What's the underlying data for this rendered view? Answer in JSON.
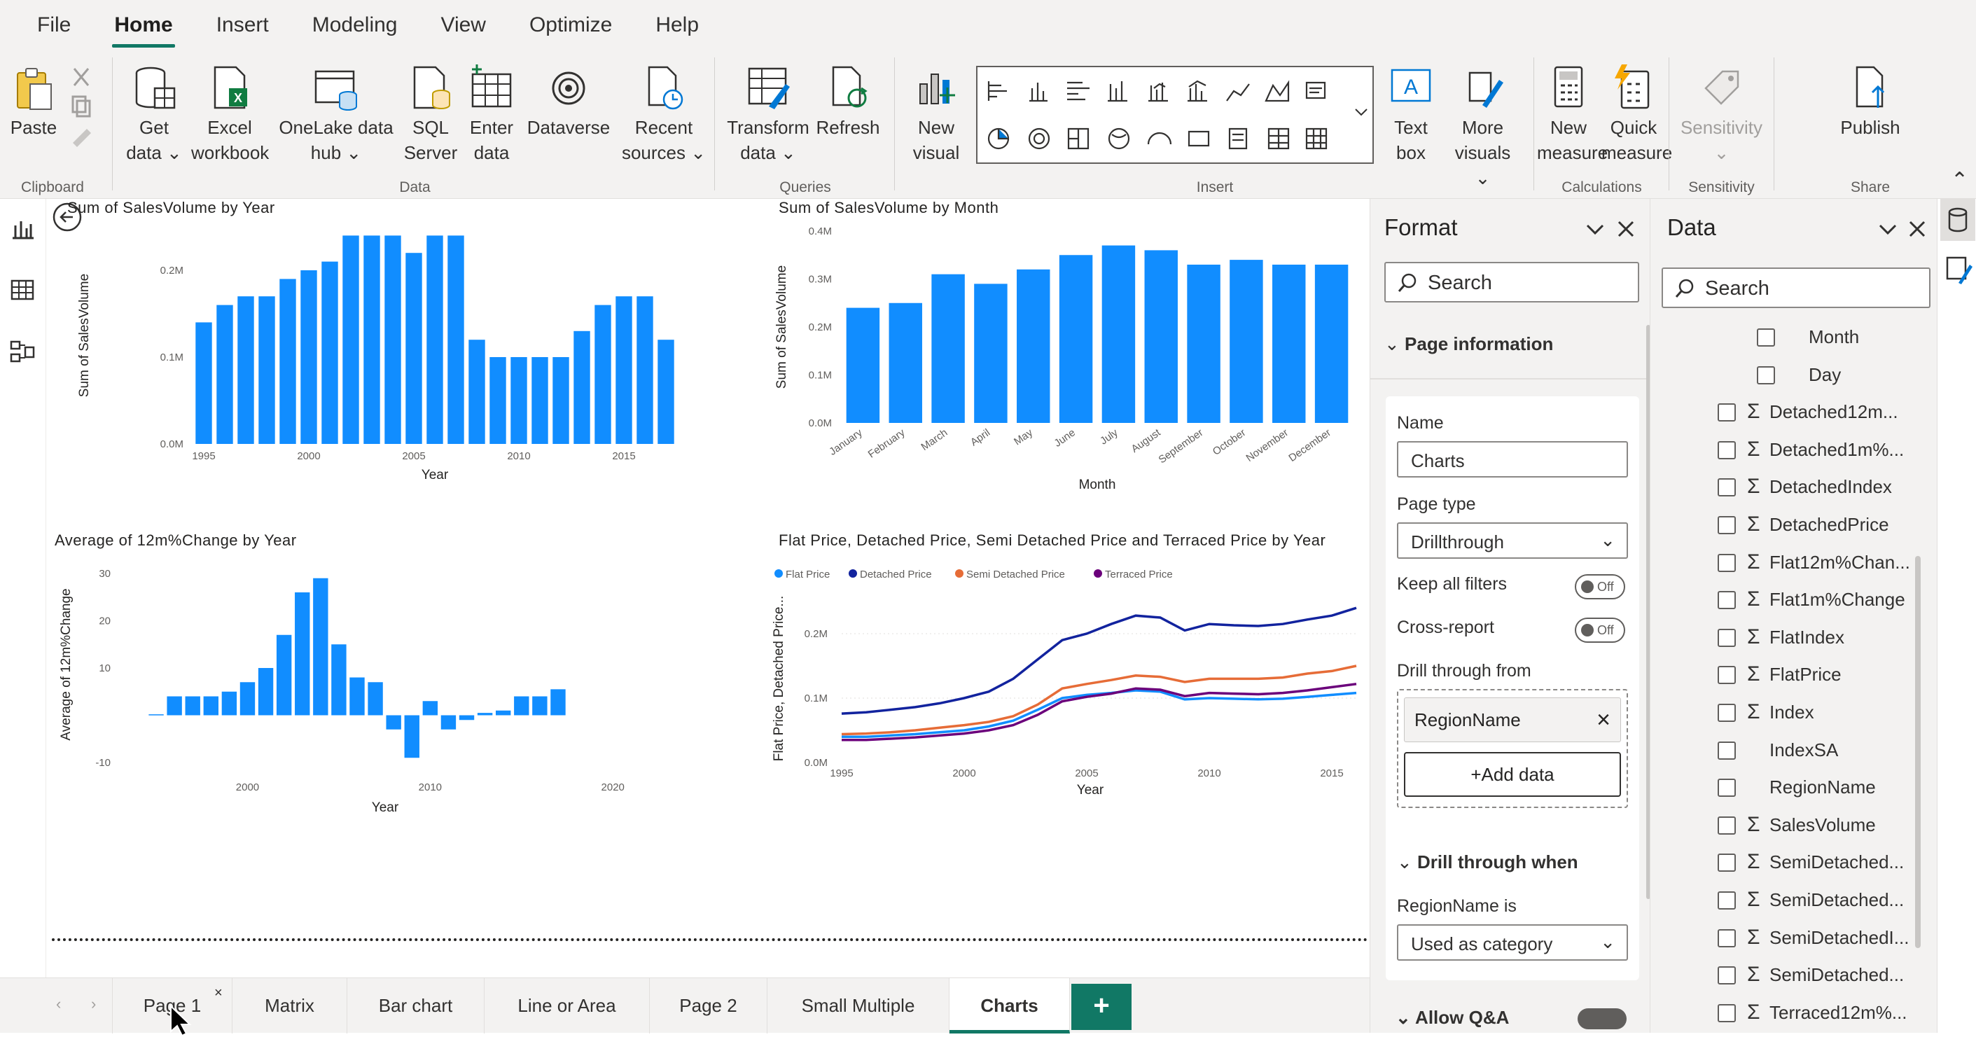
{
  "menu": {
    "items": [
      "File",
      "Home",
      "Insert",
      "Modeling",
      "View",
      "Optimize",
      "Help"
    ],
    "active": "Home"
  },
  "ribbon": {
    "clipboard": {
      "paste": "Paste",
      "group": "Clipboard"
    },
    "data": {
      "get_data": "Get",
      "get_data2": "data",
      "excel": "Excel",
      "excel2": "workbook",
      "onelake": "OneLake data",
      "onelake2": "hub",
      "sql": "SQL",
      "sql2": "Server",
      "enter": "Enter",
      "enter2": "data",
      "dataverse": "Dataverse",
      "recent": "Recent",
      "recent2": "sources",
      "group": "Data"
    },
    "queries": {
      "transform": "Transform",
      "transform2": "data",
      "refresh": "Refresh",
      "group": "Queries"
    },
    "insert": {
      "new_visual": "New",
      "new_visual2": "visual",
      "text_box": "Text",
      "text_box2": "box",
      "more_visuals": "More",
      "more_visuals2": "visuals",
      "group": "Insert"
    },
    "calculations": {
      "new_measure": "New",
      "new_measure2": "measure",
      "quick_measure": "Quick",
      "quick_measure2": "measure",
      "group": "Calculations"
    },
    "sensitivity": {
      "label": "Sensitivity",
      "group": "Sensitivity"
    },
    "share": {
      "publish": "Publish",
      "group": "Share"
    }
  },
  "charts": {
    "c1": {
      "title": "Sum of SalesVolume by Year",
      "xlabel": "Year",
      "ylabel": "Sum of SalesVolume",
      "yticks": [
        "0.2M",
        "0.1M",
        "0.0M"
      ],
      "xticks": [
        "1995",
        "2000",
        "2005",
        "2010",
        "2015"
      ]
    },
    "c2": {
      "title": "Sum of SalesVolume by Month",
      "xlabel": "Month",
      "ylabel": "Sum of SalesVolume",
      "yticks": [
        "0.4M",
        "0.3M",
        "0.2M",
        "0.1M",
        "0.0M"
      ]
    },
    "c3": {
      "title": "Average of 12m%Change by Year",
      "xlabel": "Year",
      "ylabel": "Average of 12m%Change",
      "yticks": [
        "30",
        "20",
        "10",
        "-10"
      ],
      "xticks": [
        "2000",
        "2010",
        "2020"
      ]
    },
    "c4": {
      "title": "Flat Price, Detached Price, Semi Detached Price and Terraced Price by Year",
      "xlabel": "Year",
      "ylabel": "Flat Price, Detached Price...",
      "yticks": [
        "0.2M",
        "0.1M",
        "0.0M"
      ],
      "xticks": [
        "1995",
        "2000",
        "2005",
        "2010",
        "2015"
      ],
      "legend": [
        "Flat Price",
        "Detached Price",
        "Semi Detached Price",
        "Terraced Price"
      ]
    }
  },
  "chart_data": [
    {
      "type": "bar",
      "title": "Sum of SalesVolume by Year",
      "xlabel": "Year",
      "ylabel": "Sum of SalesVolume",
      "ylim": [
        0,
        0.25
      ],
      "categories": [
        "1995",
        "1996",
        "1997",
        "1998",
        "1999",
        "2000",
        "2001",
        "2002",
        "2003",
        "2004",
        "2005",
        "2006",
        "2007",
        "2008",
        "2009",
        "2010",
        "2011",
        "2012",
        "2013",
        "2014",
        "2015",
        "2016",
        "2017"
      ],
      "values": [
        0.14,
        0.16,
        0.17,
        0.17,
        0.19,
        0.2,
        0.21,
        0.24,
        0.24,
        0.24,
        0.22,
        0.24,
        0.24,
        0.12,
        0.1,
        0.1,
        0.1,
        0.1,
        0.13,
        0.16,
        0.17,
        0.17,
        0.12
      ]
    },
    {
      "type": "bar",
      "title": "Sum of SalesVolume by Month",
      "xlabel": "Month",
      "ylabel": "Sum of SalesVolume",
      "ylim": [
        0,
        0.4
      ],
      "categories": [
        "January",
        "February",
        "March",
        "April",
        "May",
        "June",
        "July",
        "August",
        "September",
        "October",
        "November",
        "December"
      ],
      "values": [
        0.24,
        0.25,
        0.31,
        0.29,
        0.32,
        0.35,
        0.37,
        0.36,
        0.33,
        0.34,
        0.33,
        0.33
      ]
    },
    {
      "type": "bar",
      "title": "Average of 12m%Change by Year",
      "xlabel": "Year",
      "ylabel": "Average of 12m%Change",
      "ylim": [
        -10,
        30
      ],
      "categories": [
        "1995",
        "1996",
        "1997",
        "1998",
        "1999",
        "2000",
        "2001",
        "2002",
        "2003",
        "2004",
        "2005",
        "2006",
        "2007",
        "2008",
        "2009",
        "2010",
        "2011",
        "2012",
        "2013",
        "2014",
        "2015",
        "2016",
        "2017"
      ],
      "values": [
        0.2,
        4,
        4,
        4,
        5,
        7,
        10,
        17,
        26,
        29,
        15,
        8,
        7,
        -3,
        -9,
        3,
        -3,
        -1,
        0.5,
        1,
        4,
        4,
        5.5
      ]
    },
    {
      "type": "line",
      "title": "Flat Price, Detached Price, Semi Detached Price and Terraced Price by Year",
      "xlabel": "Year",
      "ylabel": "Flat Price, Detached Price...",
      "ylim": [
        0,
        0.25
      ],
      "x": [
        1995,
        1996,
        1997,
        1998,
        1999,
        2000,
        2001,
        2002,
        2003,
        2004,
        2005,
        2006,
        2007,
        2008,
        2009,
        2010,
        2011,
        2012,
        2013,
        2014,
        2015,
        2016
      ],
      "series": [
        {
          "name": "Flat Price",
          "color": "#118DFF",
          "values": [
            0.04,
            0.04,
            0.042,
            0.044,
            0.047,
            0.05,
            0.056,
            0.065,
            0.082,
            0.1,
            0.105,
            0.108,
            0.112,
            0.11,
            0.098,
            0.1,
            0.099,
            0.098,
            0.099,
            0.102,
            0.105,
            0.108
          ]
        },
        {
          "name": "Detached Price",
          "color": "#12239E",
          "values": [
            0.076,
            0.078,
            0.082,
            0.086,
            0.092,
            0.1,
            0.11,
            0.13,
            0.16,
            0.19,
            0.2,
            0.215,
            0.228,
            0.225,
            0.205,
            0.215,
            0.213,
            0.212,
            0.215,
            0.222,
            0.228,
            0.24
          ]
        },
        {
          "name": "Semi Detached Price",
          "color": "#E66C37",
          "values": [
            0.044,
            0.045,
            0.047,
            0.05,
            0.054,
            0.058,
            0.063,
            0.072,
            0.09,
            0.115,
            0.122,
            0.128,
            0.135,
            0.133,
            0.125,
            0.13,
            0.13,
            0.13,
            0.132,
            0.138,
            0.142,
            0.15
          ]
        },
        {
          "name": "Terraced Price",
          "color": "#6B007B",
          "values": [
            0.035,
            0.035,
            0.037,
            0.039,
            0.042,
            0.045,
            0.05,
            0.058,
            0.074,
            0.095,
            0.102,
            0.107,
            0.115,
            0.113,
            0.103,
            0.108,
            0.107,
            0.106,
            0.108,
            0.112,
            0.117,
            0.122
          ]
        }
      ]
    }
  ],
  "format_pane": {
    "title": "Format",
    "search_placeholder": "Search",
    "section": "Page information",
    "name_label": "Name",
    "name_value": "Charts",
    "page_type_label": "Page type",
    "page_type_value": "Drillthrough",
    "keep_filters_label": "Keep all filters",
    "keep_filters_state": "Off",
    "cross_report_label": "Cross-report",
    "cross_report_state": "Off",
    "drill_from_label": "Drill through from",
    "drill_field": "RegionName",
    "add_data": "+Add data",
    "drill_when_section": "Drill through when",
    "region_is_label": "RegionName is",
    "region_is_value": "Used as category",
    "allow_qa": "Allow Q&A"
  },
  "data_pane": {
    "title": "Data",
    "search_placeholder": "Search",
    "fields": [
      {
        "name": "Month",
        "sigma": false,
        "indent": true
      },
      {
        "name": "Day",
        "sigma": false,
        "indent": true
      },
      {
        "name": "Detached12m...",
        "sigma": true
      },
      {
        "name": "Detached1m%...",
        "sigma": true
      },
      {
        "name": "DetachedIndex",
        "sigma": true
      },
      {
        "name": "DetachedPrice",
        "sigma": true
      },
      {
        "name": "Flat12m%Chan...",
        "sigma": true
      },
      {
        "name": "Flat1m%Change",
        "sigma": true
      },
      {
        "name": "FlatIndex",
        "sigma": true
      },
      {
        "name": "FlatPrice",
        "sigma": true
      },
      {
        "name": "Index",
        "sigma": true
      },
      {
        "name": "IndexSA",
        "sigma": false
      },
      {
        "name": "RegionName",
        "sigma": false
      },
      {
        "name": "SalesVolume",
        "sigma": true
      },
      {
        "name": "SemiDetached...",
        "sigma": true
      },
      {
        "name": "SemiDetached...",
        "sigma": true
      },
      {
        "name": "SemiDetachedI...",
        "sigma": true
      },
      {
        "name": "SemiDetached...",
        "sigma": true
      },
      {
        "name": "Terraced12m%...",
        "sigma": true
      }
    ]
  },
  "tabs": {
    "items": [
      "Page 1",
      "Matrix",
      "Bar chart",
      "Line or Area",
      "Page 2",
      "Small Multiple",
      "Charts"
    ],
    "active": "Charts",
    "add": "+"
  },
  "colors": {
    "accent": "#117865",
    "bar": "#118DFF",
    "ribbon_bg": "#f3f2f1"
  }
}
